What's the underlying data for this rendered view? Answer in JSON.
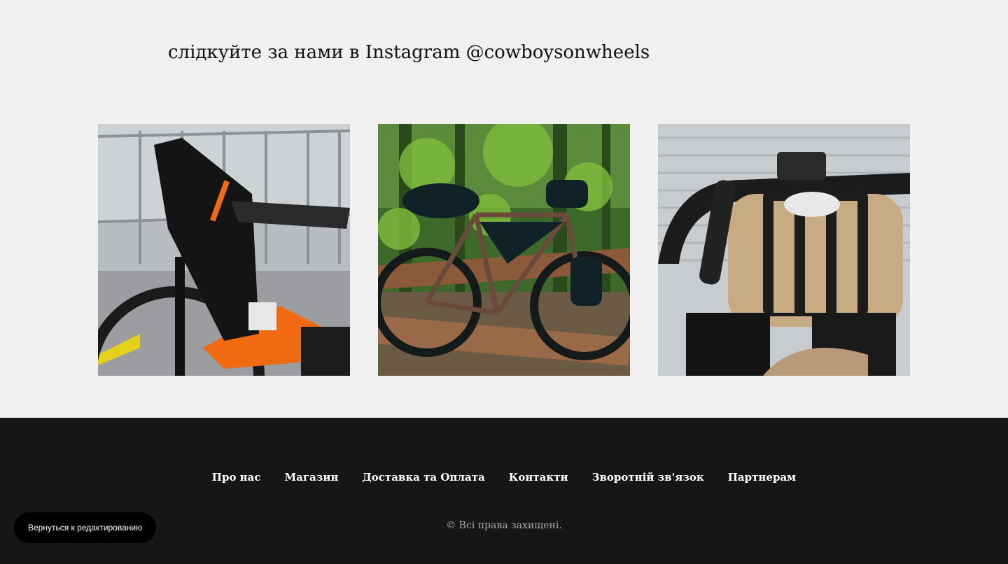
{
  "instagram": {
    "heading": "слідкуйте за нами в Instagram @cowboysonwheels"
  },
  "footer": {
    "nav": [
      "Про нас",
      "Магазин",
      "Доставка та Оплата",
      "Контакти",
      "Зворотній зв'язок",
      "Партнерам"
    ],
    "copyright": "© Всі права захищені."
  },
  "editor": {
    "back_button": "Вернуться к редактированию"
  },
  "colors": {
    "page_bg": "#f0f0f0",
    "footer_bg": "#161616",
    "button_bg": "#000000"
  }
}
